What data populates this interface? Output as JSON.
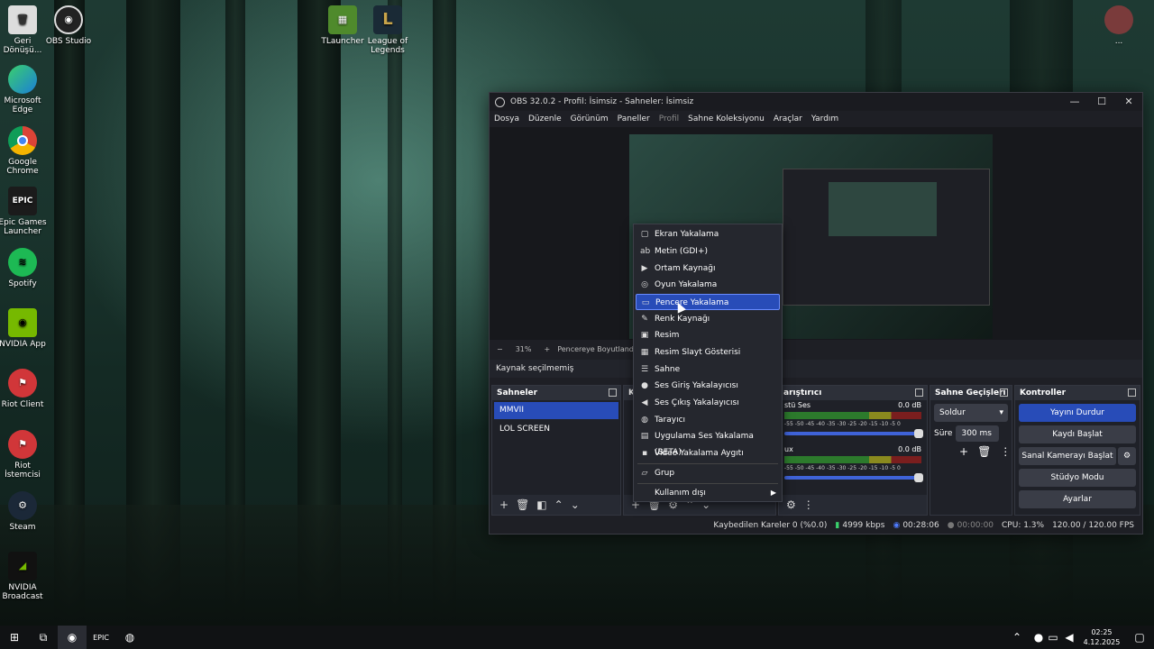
{
  "desktop": {
    "icons": [
      {
        "label": "Geri\nDönüşü...",
        "name": "recycle-bin-icon"
      },
      {
        "label": "OBS Studio",
        "name": "obs-studio-icon"
      },
      {
        "label": "TLauncher",
        "name": "tlauncher-icon"
      },
      {
        "label": "League of\nLegends",
        "name": "league-of-legends-icon"
      },
      {
        "label": "Microsoft\nEdge",
        "name": "edge-icon"
      },
      {
        "label": "Google\nChrome",
        "name": "chrome-icon"
      },
      {
        "label": "Epic Games\nLauncher",
        "name": "epic-games-icon"
      },
      {
        "label": "Spotify",
        "name": "spotify-icon"
      },
      {
        "label": "NVIDIA App",
        "name": "nvidia-app-icon"
      },
      {
        "label": "Riot Client",
        "name": "riot-client-icon"
      },
      {
        "label": "Riot İstemcisi",
        "name": "riot-istemcisi-icon"
      },
      {
        "label": "Steam",
        "name": "steam-icon"
      },
      {
        "label": "NVIDIA\nBroadcast",
        "name": "nvidia-broadcast-icon"
      },
      {
        "label": "...",
        "name": "user-folder-icon"
      }
    ]
  },
  "obs": {
    "title": "OBS 32.0.2 - Profil: İsimsiz - Sahneler: İsimsiz",
    "menu": [
      "Dosya",
      "Düzenle",
      "Görünüm",
      "Paneller",
      "Profil",
      "Sahne Koleksiyonu",
      "Araçlar",
      "Yardım"
    ],
    "zoom": "31%",
    "zoom_mode": "Pencereye Boyutlandır",
    "source_status": "Kaynak seçilmemiş",
    "scenes_title": "Sahneler",
    "scenes": [
      "MMVII",
      "LOL SCREEN"
    ],
    "sources_title_partial": "K",
    "mixer_title": "Karıştırıcı",
    "mixer_title_visible": "arıştırıcı",
    "mixer_channels": [
      {
        "name": "Masaüstü Ses",
        "name_visible": "stü Ses",
        "db": "0.0 dB"
      },
      {
        "name": "Mic/Aux",
        "name_visible": "ux",
        "db": "0.0 dB"
      }
    ],
    "meter_scale": "-55 -50 -45 -40 -35 -30 -25 -20 -15 -10 -5 0",
    "transitions_title": "Sahne Geçişleri",
    "transition_value": "Soldur",
    "duration_label": "Süre",
    "duration_value": "300 ms",
    "controls_title": "Kontroller",
    "controls": [
      "Yayını Durdur",
      "Kaydı Başlat",
      "Sanal Kamerayı Başlat",
      "Stüdyo Modu",
      "Ayarlar"
    ],
    "status": {
      "dropped": "Kaybedilen Kareler 0 (%0.0)",
      "bitrate": "4999 kbps",
      "stream_time": "00:28:06",
      "rec_time": "00:00:00",
      "cpu": "CPU: 1.3%",
      "fps": "120.00 / 120.00 FPS"
    }
  },
  "context_menu": {
    "items": [
      {
        "label": "Ekran Yakalama",
        "icon": "monitor-icon",
        "glyph": "▢"
      },
      {
        "label": "Metin (GDI+)",
        "icon": "text-icon",
        "glyph": "ab"
      },
      {
        "label": "Ortam Kaynağı",
        "icon": "play-icon",
        "glyph": "▶"
      },
      {
        "label": "Oyun Yakalama",
        "icon": "gamepad-icon",
        "glyph": "◎"
      },
      {
        "label": "Pencere Yakalama",
        "icon": "window-icon",
        "glyph": "▭"
      },
      {
        "label": "Renk Kaynağı",
        "icon": "brush-icon",
        "glyph": "✎"
      },
      {
        "label": "Resim",
        "icon": "image-icon",
        "glyph": "▣"
      },
      {
        "label": "Resim Slayt Gösterisi",
        "icon": "slideshow-icon",
        "glyph": "▦"
      },
      {
        "label": "Sahne",
        "icon": "list-icon",
        "glyph": "☰"
      },
      {
        "label": "Ses Giriş Yakalayıcısı",
        "icon": "microphone-icon",
        "glyph": "●"
      },
      {
        "label": "Ses Çıkış Yakalayıcısı",
        "icon": "speaker-icon",
        "glyph": "◀"
      },
      {
        "label": "Tarayıcı",
        "icon": "globe-icon",
        "glyph": "◍"
      },
      {
        "label": "Uygulama Ses Yakalama (BETA)",
        "icon": "app-audio-icon",
        "glyph": "▤"
      },
      {
        "label": "Video Yakalama Aygıtı",
        "icon": "camera-icon",
        "glyph": "▪"
      },
      {
        "label": "Grup",
        "icon": "folder-icon",
        "glyph": "▱"
      },
      {
        "label": "Kullanım dışı",
        "icon": "",
        "glyph": ""
      }
    ],
    "highlighted": "Pencere Yakalama"
  },
  "taskbar": {
    "time": "02:25",
    "date": "4.12.2025"
  }
}
